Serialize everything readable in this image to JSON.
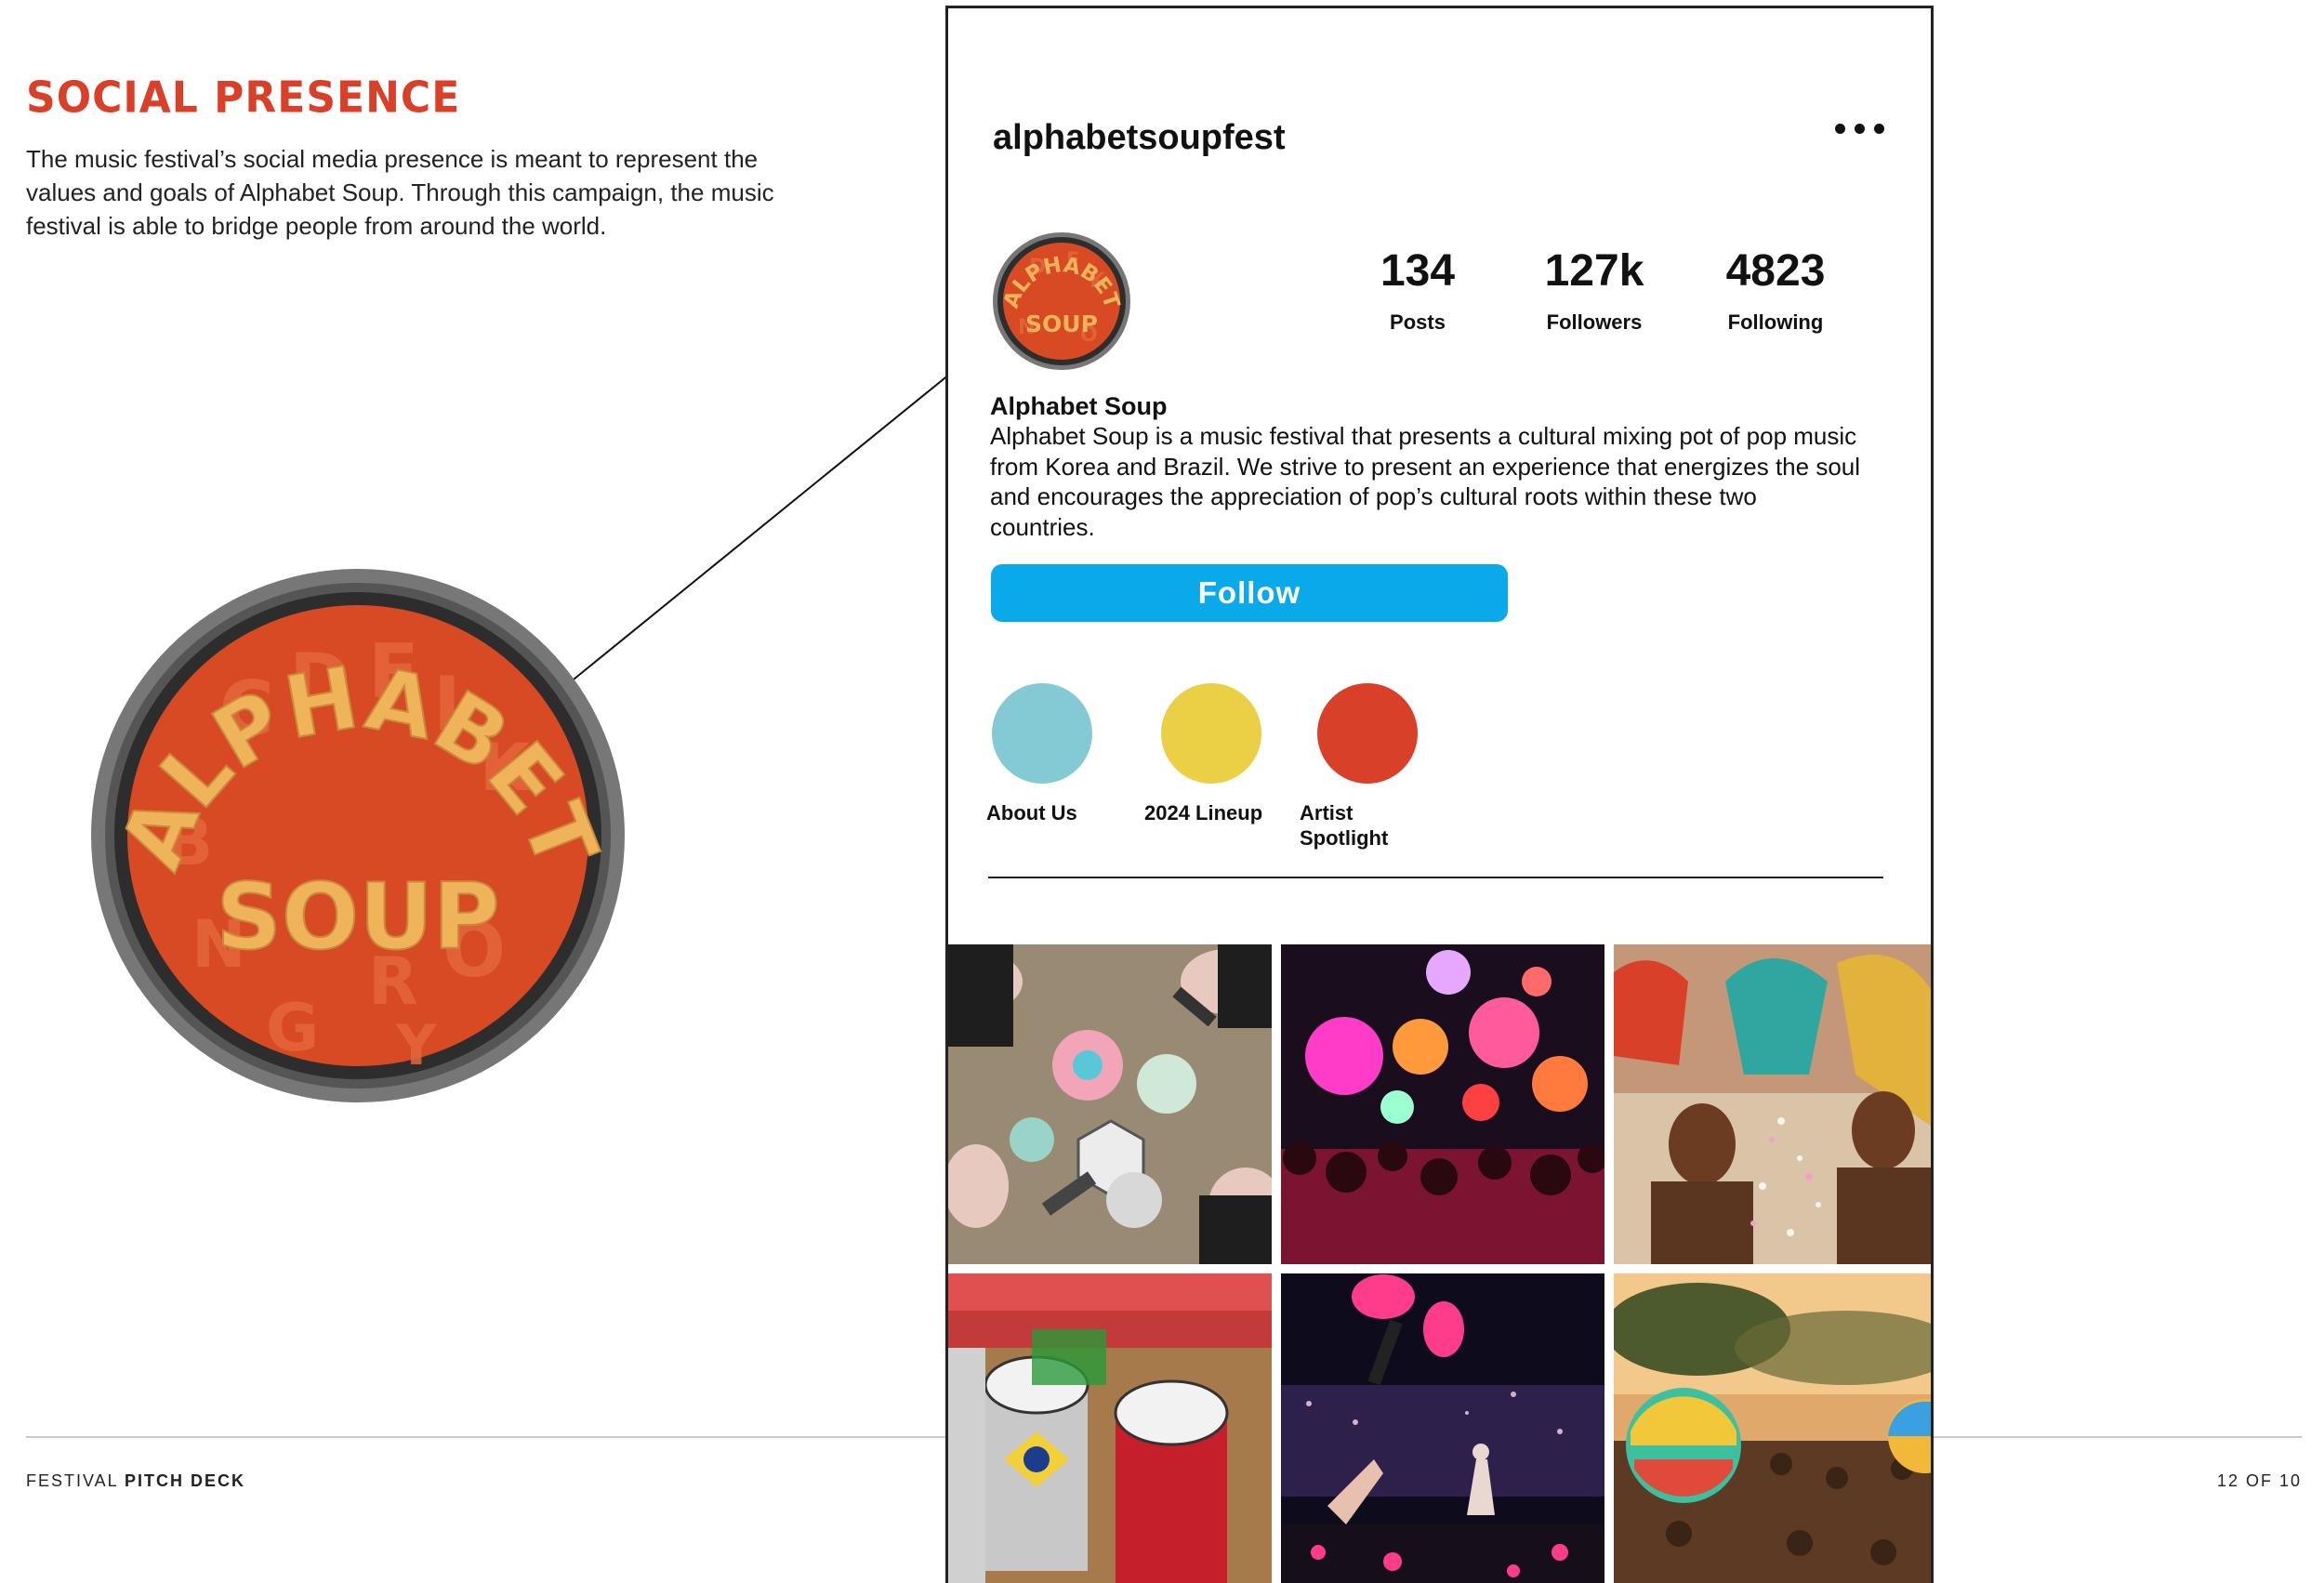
{
  "section": {
    "title": "SOCIAL PRESENCE",
    "intro": "The music festival’s social media presence is meant to represent the values and goals of Alphabet Soup. Through this campaign, the music festival is able to bridge people from around the world."
  },
  "logo": {
    "word_top": "ALPHABET",
    "word_bottom": "SOUP"
  },
  "footer": {
    "left_regular": "FESTIVAL ",
    "left_bold": "PITCH DECK",
    "page": "12 OF 10"
  },
  "profile": {
    "username": "alphabetsoupfest",
    "menu_icon": "more-horizontal-icon",
    "stats": {
      "posts_value": "134",
      "posts_label": "Posts",
      "followers_value": "127k",
      "followers_label": "Followers",
      "following_value": "4823",
      "following_label": "Following"
    },
    "bio_name": "Alphabet Soup",
    "bio_text": "Alphabet Soup is a music festival that presents a cultural mixing pot of pop music from Korea and Brazil. We strive to present an experience that energizes the soul and encourages the appreciation of pop’s cultural roots within these two countries.",
    "follow_label": "Follow",
    "highlights": [
      {
        "label": "About Us",
        "color": "#84cad5"
      },
      {
        "label": "2024 Lineup",
        "color": "#ebcf45"
      },
      {
        "label": "Artist Spotlight",
        "color": "#d8402a"
      }
    ]
  },
  "colors": {
    "accent_red": "#d8402a",
    "follow_blue": "#0aa9ea",
    "soup_orange": "#d74a23",
    "letter_tan": "#efb45a"
  },
  "posts": [
    {
      "subject": "fans holding k-pop lightsticks"
    },
    {
      "subject": "glowing balloons over concert crowd"
    },
    {
      "subject": "brazilian carnival dancers with confetti"
    },
    {
      "subject": "samba drummers with brazil flag"
    },
    {
      "subject": "k-pop concert crowd with pink lightsticks"
    },
    {
      "subject": "festival crowd with beach balls at sunset"
    }
  ]
}
